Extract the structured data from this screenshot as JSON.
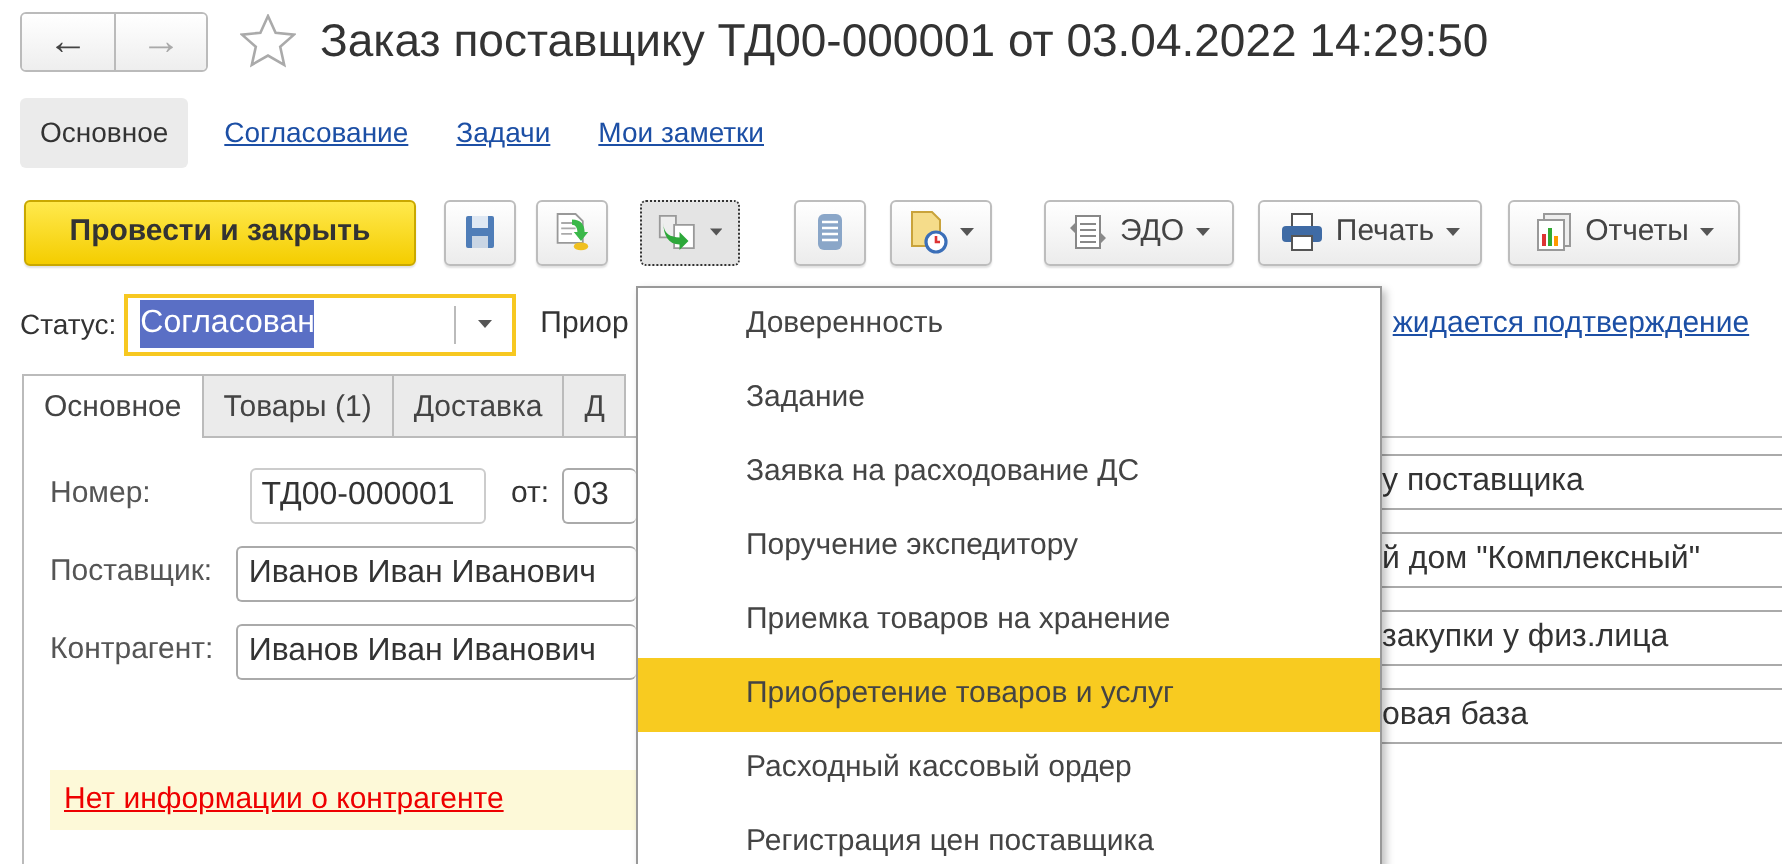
{
  "window": {
    "title": "Заказ поставщику ТД00-000001 от 03.04.2022 14:29:50",
    "favorite": false
  },
  "nav_buttons": [
    {
      "label": "←",
      "disabled": false
    },
    {
      "label": "→",
      "disabled": true
    }
  ],
  "sections": [
    {
      "label": "Основное",
      "selected": true
    },
    {
      "label": "Согласование",
      "selected": false
    },
    {
      "label": "Задачи",
      "selected": false
    },
    {
      "label": "Мои заметки",
      "selected": false
    }
  ],
  "toolbar": [
    {
      "kind": "primary",
      "label": "Провести и закрыть",
      "dropdown": false,
      "pressed": false
    },
    {
      "kind": "icon",
      "dropdown": false,
      "pressed": false
    },
    {
      "kind": "icon",
      "dropdown": false,
      "pressed": false
    },
    {
      "kind": "icon",
      "dropdown": true,
      "pressed": true
    },
    {
      "kind": "icon",
      "dropdown": false,
      "pressed": false
    },
    {
      "kind": "icon",
      "dropdown": true,
      "pressed": false
    },
    {
      "kind": "labeled",
      "label": "ЭДО",
      "dropdown": true,
      "pressed": false
    },
    {
      "kind": "labeled",
      "label": "Печать",
      "dropdown": true,
      "pressed": false
    },
    {
      "kind": "labeled",
      "label": "Отчеты",
      "dropdown": true,
      "pressed": false
    }
  ],
  "status": {
    "label": "Статус:",
    "value": "Согласован",
    "text_selected": true,
    "focused": true
  },
  "priority_label": "Приор",
  "confirmation_link": "жидается подтверждение",
  "tabs": [
    {
      "label": "Основное",
      "selected": true
    },
    {
      "label": "Товары (1)",
      "selected": false
    },
    {
      "label": "Доставка",
      "selected": false
    },
    {
      "label": "Д",
      "selected": false
    }
  ],
  "fields_left": [
    {
      "label": "Номер:",
      "value": "ТД00-000001",
      "date_label": "от:",
      "date_value": "03"
    },
    {
      "label": "Поставщик:",
      "value": "Иванов Иван Иванович"
    },
    {
      "label": "Контрагент:",
      "value": "Иванов Иван Иванович"
    }
  ],
  "fields_right": [
    "у поставщика",
    "й дом \"Комплексный\"",
    "закупки у физ.лица",
    "овая база"
  ],
  "warning": "Нет информации о контрагенте",
  "menu": {
    "items": [
      {
        "label": "Доверенность",
        "selected": false
      },
      {
        "label": "Задание",
        "selected": false
      },
      {
        "label": "Заявка на расходование ДС",
        "selected": false
      },
      {
        "label": "Поручение экспедитору",
        "selected": false
      },
      {
        "label": "Приемка товаров на хранение",
        "selected": false
      },
      {
        "label": "Приобретение товаров и услуг",
        "selected": true
      },
      {
        "label": "Расходный кассовый ордер",
        "selected": false
      },
      {
        "label": "Регистрация цен поставщика",
        "selected": false
      }
    ]
  }
}
